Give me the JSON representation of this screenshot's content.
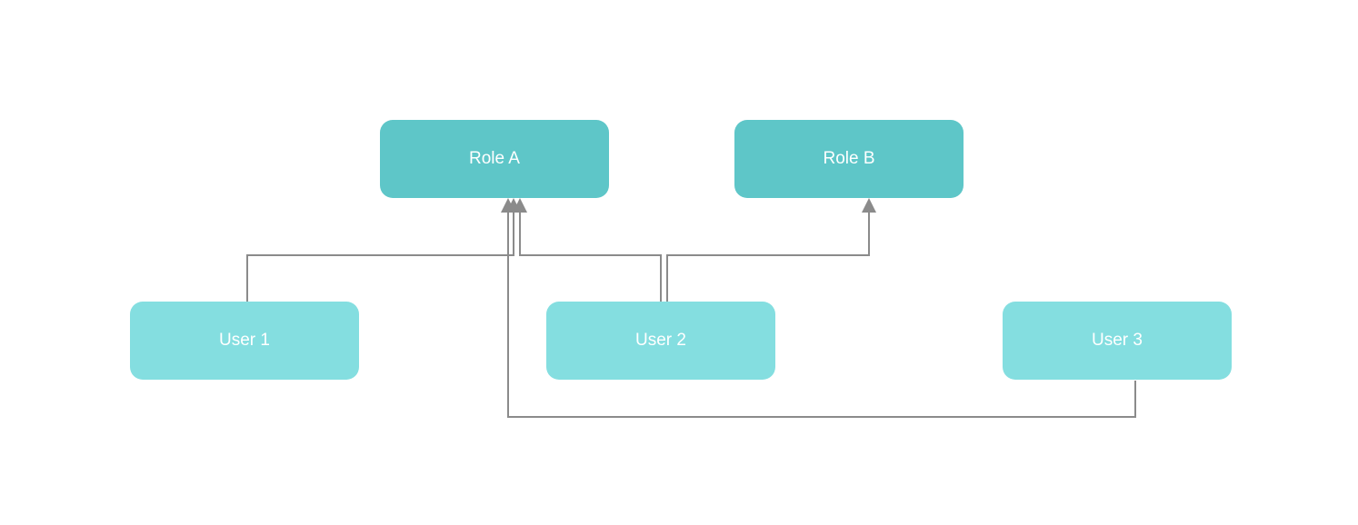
{
  "diagram": {
    "roles": [
      {
        "label": "Role A"
      },
      {
        "label": "Role B"
      }
    ],
    "users": [
      {
        "label": "User 1"
      },
      {
        "label": "User 2"
      },
      {
        "label": "User 3"
      }
    ],
    "edges": [
      {
        "from": "User 1",
        "to": "Role A"
      },
      {
        "from": "User 2",
        "to": "Role A"
      },
      {
        "from": "User 2",
        "to": "Role B"
      },
      {
        "from": "User 3",
        "to": "Role A"
      }
    ]
  },
  "colors": {
    "role_fill": "#5ec6c8",
    "user_fill": "#84dee0",
    "text": "#ffffff",
    "connector": "#8b8b8b"
  }
}
